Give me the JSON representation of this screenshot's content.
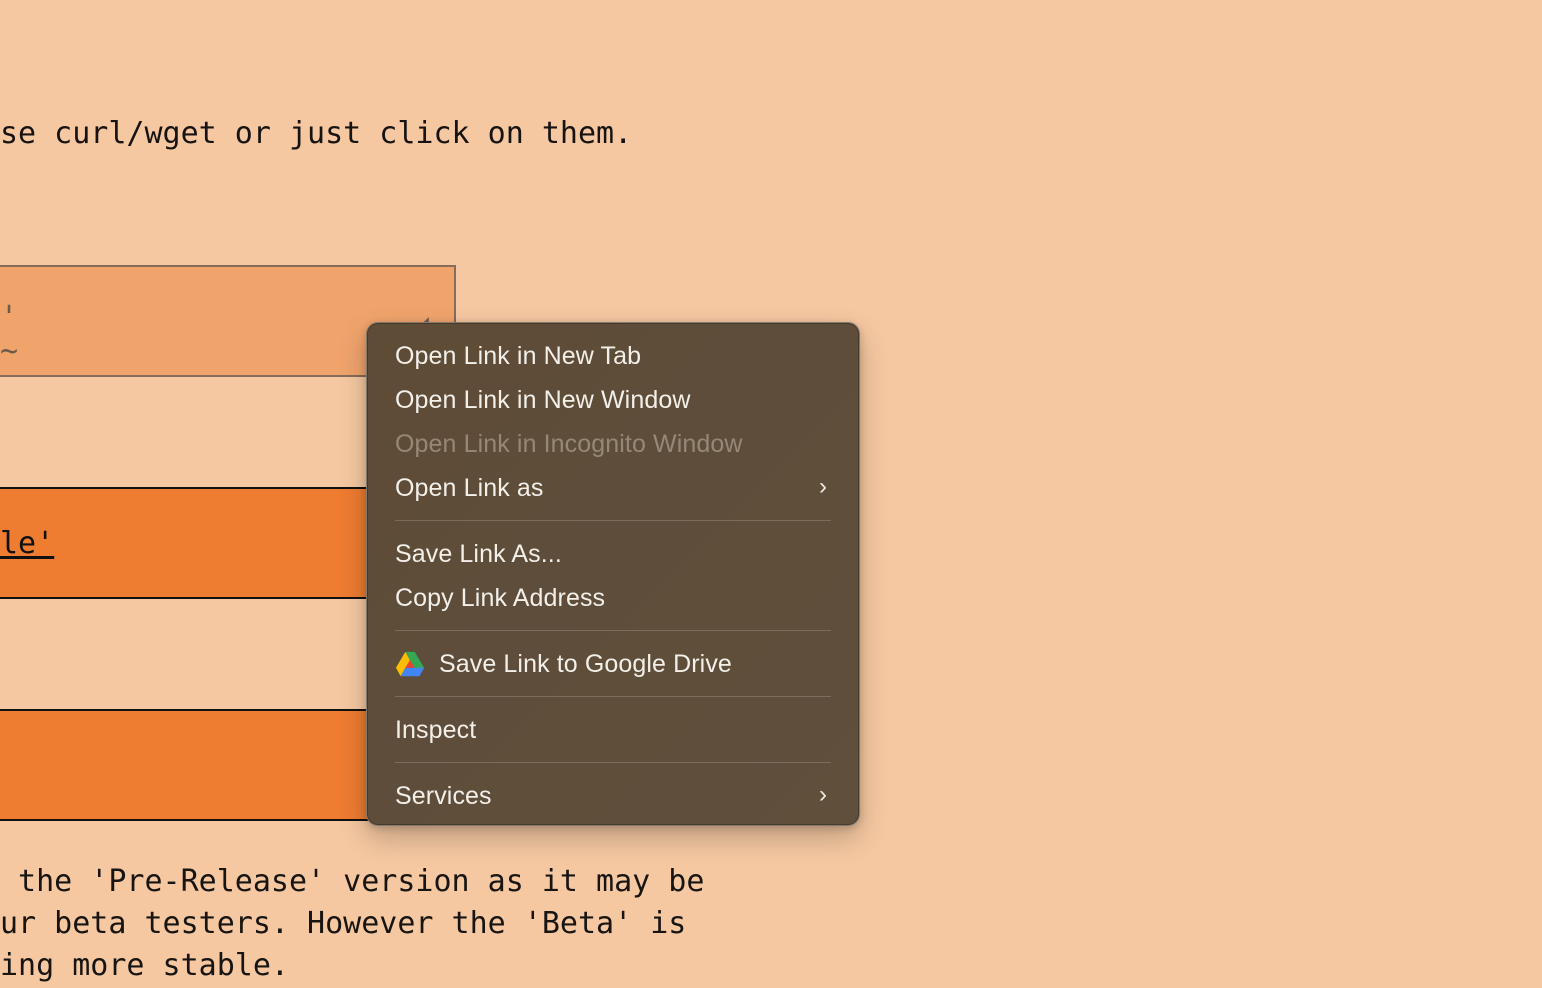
{
  "page": {
    "top_text": "se curl/wget or just click on them.",
    "partial_glyph": "'\n~",
    "mid_link_text": "le'",
    "bottom_lines": [
      " the 'Pre-Release' version as it may be",
      "ur beta testers. However the 'Beta' is",
      "ing more stable."
    ]
  },
  "context_menu": {
    "items": [
      {
        "label": "Open Link in New Tab",
        "enabled": true
      },
      {
        "label": "Open Link in New Window",
        "enabled": true
      },
      {
        "label": "Open Link in Incognito Window",
        "enabled": false
      },
      {
        "label": "Open Link as",
        "enabled": true,
        "submenu": true
      },
      {
        "label": "Save Link As...",
        "enabled": true
      },
      {
        "label": "Copy Link Address",
        "enabled": true
      },
      {
        "label": "Save Link to Google Drive",
        "enabled": true,
        "icon": "google-drive-icon"
      },
      {
        "label": "Inspect",
        "enabled": true
      },
      {
        "label": "Services",
        "enabled": true,
        "submenu": true
      }
    ],
    "chevron": "›"
  },
  "colors": {
    "page_background": "#f5c8a1",
    "light_box": "#f0a46c",
    "orange_box": "#ee7c31",
    "menu_background": "#5e4c36",
    "menu_text": "#f3efe9",
    "menu_disabled_text": "#9b8b78"
  }
}
